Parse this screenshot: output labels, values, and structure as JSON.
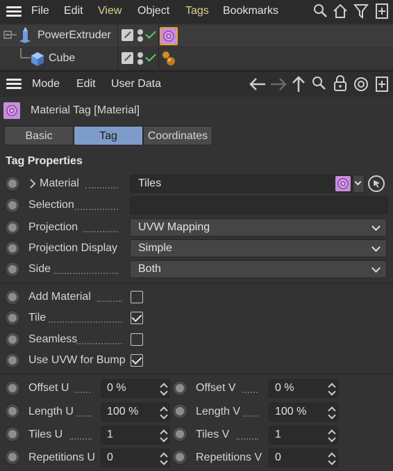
{
  "menubar": {
    "items": [
      "File",
      "Edit",
      "View",
      "Object",
      "Tags",
      "Bookmarks"
    ],
    "highlighted": [
      "View",
      "Tags"
    ],
    "icons": [
      "search-icon",
      "home-icon",
      "filter-icon",
      "new-panel-icon"
    ]
  },
  "object_tree": {
    "objects": [
      {
        "name": "PowerExtruder",
        "icon": "extruder-icon",
        "selected": true
      },
      {
        "name": "Cube",
        "icon": "cube-icon",
        "selected": false
      }
    ]
  },
  "attribute_manager": {
    "menu": [
      "Mode",
      "Edit",
      "User Data"
    ],
    "icons": [
      "back-arrow-icon",
      "forward-arrow-icon",
      "up-arrow-icon",
      "search-icon",
      "lock-icon",
      "target-icon",
      "new-panel-icon"
    ],
    "tag_title": "Material Tag [Material]",
    "tabs": [
      "Basic",
      "Tag",
      "Coordinates"
    ],
    "active_tab": "Tag",
    "section_title": "Tag Properties",
    "properties": {
      "material": {
        "label": "Material",
        "value": "Tiles"
      },
      "selection": {
        "label": "Selection",
        "value": ""
      },
      "projection": {
        "label": "Projection",
        "value": "UVW Mapping"
      },
      "projection_display": {
        "label": "Projection Display",
        "value": "Simple"
      },
      "side": {
        "label": "Side",
        "value": "Both"
      }
    },
    "checkboxes": {
      "add_material": {
        "label": "Add Material",
        "checked": false
      },
      "tile": {
        "label": "Tile",
        "checked": true
      },
      "seamless": {
        "label": "Seamless",
        "checked": false
      },
      "use_uvw_for_bump": {
        "label": "Use UVW for Bump",
        "checked": true
      }
    },
    "numeric": {
      "offset_u": {
        "label": "Offset U",
        "value": "0 %"
      },
      "offset_v": {
        "label": "Offset V",
        "value": "0 %"
      },
      "length_u": {
        "label": "Length U",
        "value": "100 %"
      },
      "length_v": {
        "label": "Length V",
        "value": "100 %"
      },
      "tiles_u": {
        "label": "Tiles U",
        "value": "1"
      },
      "tiles_v": {
        "label": "Tiles V",
        "value": "1"
      },
      "repetitions_u": {
        "label": "Repetitions U",
        "value": "0"
      },
      "repetitions_v": {
        "label": "Repetitions V",
        "value": "0"
      }
    }
  },
  "colors": {
    "active_tab": "#7e9cc9",
    "highlight_menu": "#d8d38a",
    "check_green": "#5fd05f"
  }
}
